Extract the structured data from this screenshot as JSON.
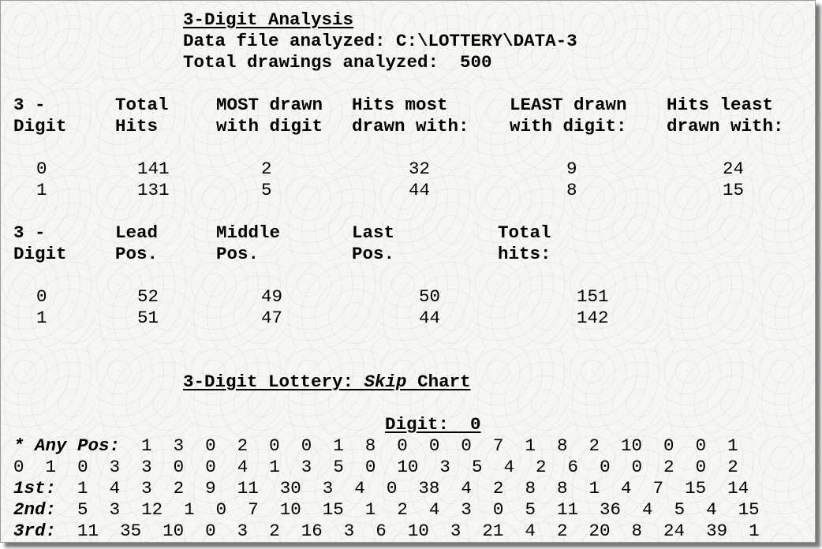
{
  "header": {
    "title": "3-Digit Analysis",
    "data_file_line": "Data file analyzed: C:\\LOTTERY\\DATA-3",
    "total_drawings_line": "Total drawings analyzed:  500"
  },
  "table1": {
    "headers": [
      [
        "3 -",
        "Digit"
      ],
      [
        "Total",
        "Hits"
      ],
      [
        "MOST drawn",
        "with digit"
      ],
      [
        "Hits most",
        "drawn with:"
      ],
      [
        "LEAST drawn",
        "with digit:"
      ],
      [
        "Hits least",
        "drawn with:"
      ]
    ],
    "rows": [
      [
        "0",
        "141",
        "2",
        "32",
        "9",
        "24"
      ],
      [
        "1",
        "131",
        "5",
        "44",
        "8",
        "15"
      ]
    ]
  },
  "table2": {
    "headers": [
      [
        "3 -",
        "Digit"
      ],
      [
        "Lead",
        "Pos."
      ],
      [
        "Middle",
        "Pos."
      ],
      [
        "Last",
        "Pos."
      ],
      [
        "Total",
        "hits:"
      ]
    ],
    "rows": [
      [
        "0",
        "52",
        "49",
        "50",
        "151"
      ],
      [
        "1",
        "51",
        "47",
        "44",
        "142"
      ]
    ]
  },
  "skip_chart": {
    "title_prefix": "3-Digit Lottery: ",
    "title_italic": "Skip",
    "title_suffix": " Chart",
    "digit_label": "Digit:  0",
    "rows": [
      {
        "label": "* Any Pos:",
        "values": [
          "1",
          "3",
          "0",
          "2",
          "0",
          "0",
          "1",
          "8",
          "0",
          "0",
          "0",
          "7",
          "1",
          "8",
          "2",
          "10",
          "0",
          "0",
          "1"
        ]
      },
      {
        "label": "",
        "values": [
          "0",
          "1",
          "0",
          "3",
          "3",
          "0",
          "0",
          "4",
          "1",
          "3",
          "5",
          "0",
          "10",
          "3",
          "5",
          "4",
          "2",
          "6",
          "0",
          "0",
          "2",
          "0",
          "2"
        ]
      },
      {
        "label": "1st:",
        "values": [
          "1",
          "4",
          "3",
          "2",
          "9",
          "11",
          "30",
          "3",
          "4",
          "0",
          "38",
          "4",
          "2",
          "8",
          "8",
          "1",
          "4",
          "7",
          "15",
          "14"
        ]
      },
      {
        "label": "2nd:",
        "values": [
          "5",
          "3",
          "12",
          "1",
          "0",
          "7",
          "10",
          "15",
          "1",
          "2",
          "4",
          "3",
          "0",
          "5",
          "11",
          "36",
          "4",
          "5",
          "4",
          "15"
        ]
      },
      {
        "label": "3rd:",
        "values": [
          "11",
          "35",
          "10",
          "0",
          "3",
          "2",
          "16",
          "3",
          "6",
          "10",
          "3",
          "21",
          "4",
          "2",
          "20",
          "8",
          "24",
          "39",
          "1"
        ]
      }
    ]
  }
}
